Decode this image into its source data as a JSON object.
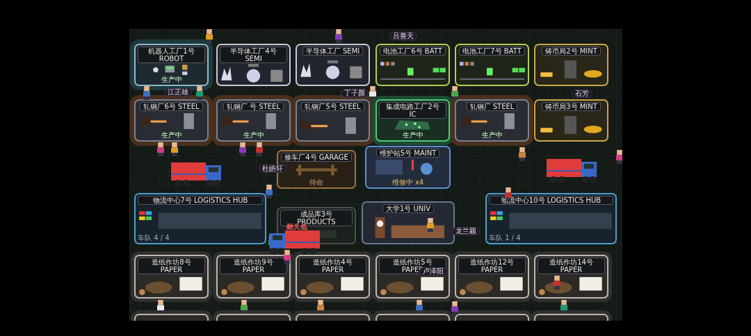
{
  "map": {
    "buildings": [
      {
        "title": "机器人工厂1号 ROBOT",
        "kind": "robot",
        "status": "生产中"
      },
      {
        "title": "半导体工厂4号 SEMI",
        "kind": "semi"
      },
      {
        "title": "半导体工厂 SEMI",
        "kind": "semi"
      },
      {
        "title": "电池工厂6号 BATT",
        "kind": "batt"
      },
      {
        "title": "电池工厂7号 BATT",
        "kind": "batt"
      },
      {
        "title": "铸币局2号 MINT",
        "kind": "mint"
      },
      {
        "title": "轧钢厂6号 STEEL",
        "kind": "steel",
        "status": "生产中"
      },
      {
        "title": "轧钢厂 号 STEEL",
        "kind": "steel",
        "status": "生产中"
      },
      {
        "title": "轧钢厂5号 STEEL",
        "kind": "steel"
      },
      {
        "title": "集成电路工厂2号 IC",
        "kind": "ic",
        "status": "生产中"
      },
      {
        "title": "轧钢厂 STEEL",
        "kind": "steel",
        "status": "生产中"
      },
      {
        "title": "铸币局3号 MINT",
        "kind": "mint"
      },
      {
        "title": "修车厂4号 GARAGE",
        "kind": "garage",
        "status": "待命"
      },
      {
        "title": "维护站5号 MAINT",
        "kind": "maint",
        "status": "维修中 x4"
      },
      {
        "title": "物流中心7号 LOGISTICS HUB",
        "kind": "logistics",
        "status": "车队 4 / 4"
      },
      {
        "title": "成品库3号 PRODUCTS",
        "kind": "products"
      },
      {
        "title": "大学1号 UNIV",
        "kind": "univ"
      },
      {
        "title": "物流中心10号 LOGISTICS HUB",
        "kind": "logistics",
        "status": "车队 1 / 4"
      },
      {
        "title": "造纸作坊8号 PAPER",
        "kind": "paper"
      },
      {
        "title": "造纸作坊9号 PAPER",
        "kind": "paper"
      },
      {
        "title": "造纸作坊4号 PAPER",
        "kind": "paper"
      },
      {
        "title": "造纸作坊5号 PAPER",
        "kind": "paper"
      },
      {
        "title": "造纸作坊12号 PAPER",
        "kind": "paper"
      },
      {
        "title": "造纸作坊14号 PAPER",
        "kind": "paper"
      }
    ],
    "name_tags": [
      "江正雄",
      "丁子颜",
      "吕善天",
      "石芳",
      "杜皓轩",
      "卢泽阳",
      "龙兰颖"
    ],
    "truck_warning": "耐久低"
  }
}
